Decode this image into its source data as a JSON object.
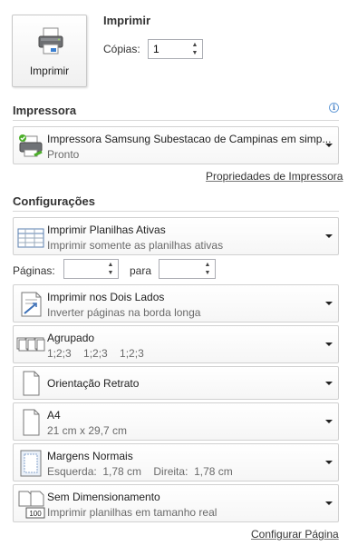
{
  "print": {
    "button_label": "Imprimir",
    "title": "Imprimir",
    "copies_label": "Cópias:",
    "copies_value": "1"
  },
  "printer": {
    "heading": "Impressora",
    "info_icon": "info-icon",
    "name": "Impressora Samsung Subestacao de Campinas em simp...",
    "status": "Pronto",
    "properties_link": "Propriedades de Impressora"
  },
  "settings": {
    "heading": "Configurações",
    "what_to_print": {
      "title": "Imprimir Planilhas Ativas",
      "subtitle": "Imprimir somente as planilhas ativas"
    },
    "pages": {
      "label": "Páginas:",
      "from_value": "",
      "to_label": "para",
      "to_value": ""
    },
    "sides": {
      "title": "Imprimir nos Dois Lados",
      "subtitle": "Inverter páginas na borda longa"
    },
    "collation": {
      "title": "Agrupado",
      "subtitle": "1;2;3    1;2;3    1;2;3"
    },
    "orientation": {
      "title": "Orientação Retrato"
    },
    "paper": {
      "title": "A4",
      "subtitle": "21 cm x 29,7 cm"
    },
    "margins": {
      "title": "Margens Normais",
      "subtitle": "Esquerda:  1,78 cm    Direita:  1,78 cm"
    },
    "scaling": {
      "title": "Sem Dimensionamento",
      "subtitle": "Imprimir planilhas em tamanho real",
      "icon_text": "100"
    },
    "page_setup_link": "Configurar Página"
  }
}
